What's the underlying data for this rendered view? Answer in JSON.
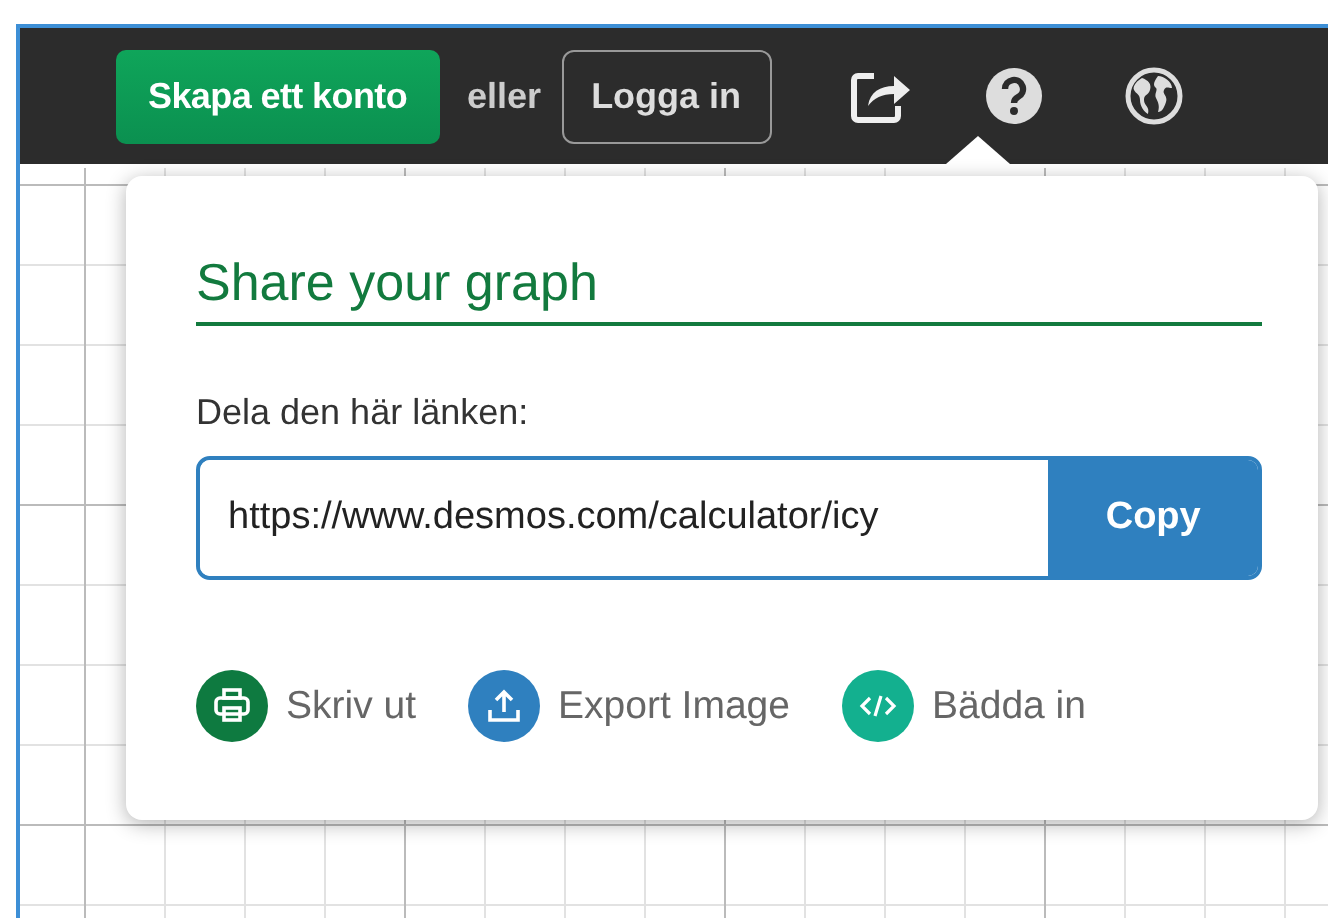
{
  "topbar": {
    "signup_button": "Skapa ett konto",
    "or_text": "eller",
    "login_button": "Logga in"
  },
  "share_popup": {
    "title": "Share your graph",
    "link_label": "Dela den här länken:",
    "link_value": "https://www.desmos.com/calculator/icy",
    "copy_button": "Copy",
    "actions": [
      {
        "kind": "print",
        "label": "Skriv ut",
        "color": "#0e7a40"
      },
      {
        "kind": "export",
        "label": "Export Image",
        "color": "#2f80bf"
      },
      {
        "kind": "embed",
        "label": "Bädda in",
        "color": "#13b08f"
      }
    ]
  }
}
